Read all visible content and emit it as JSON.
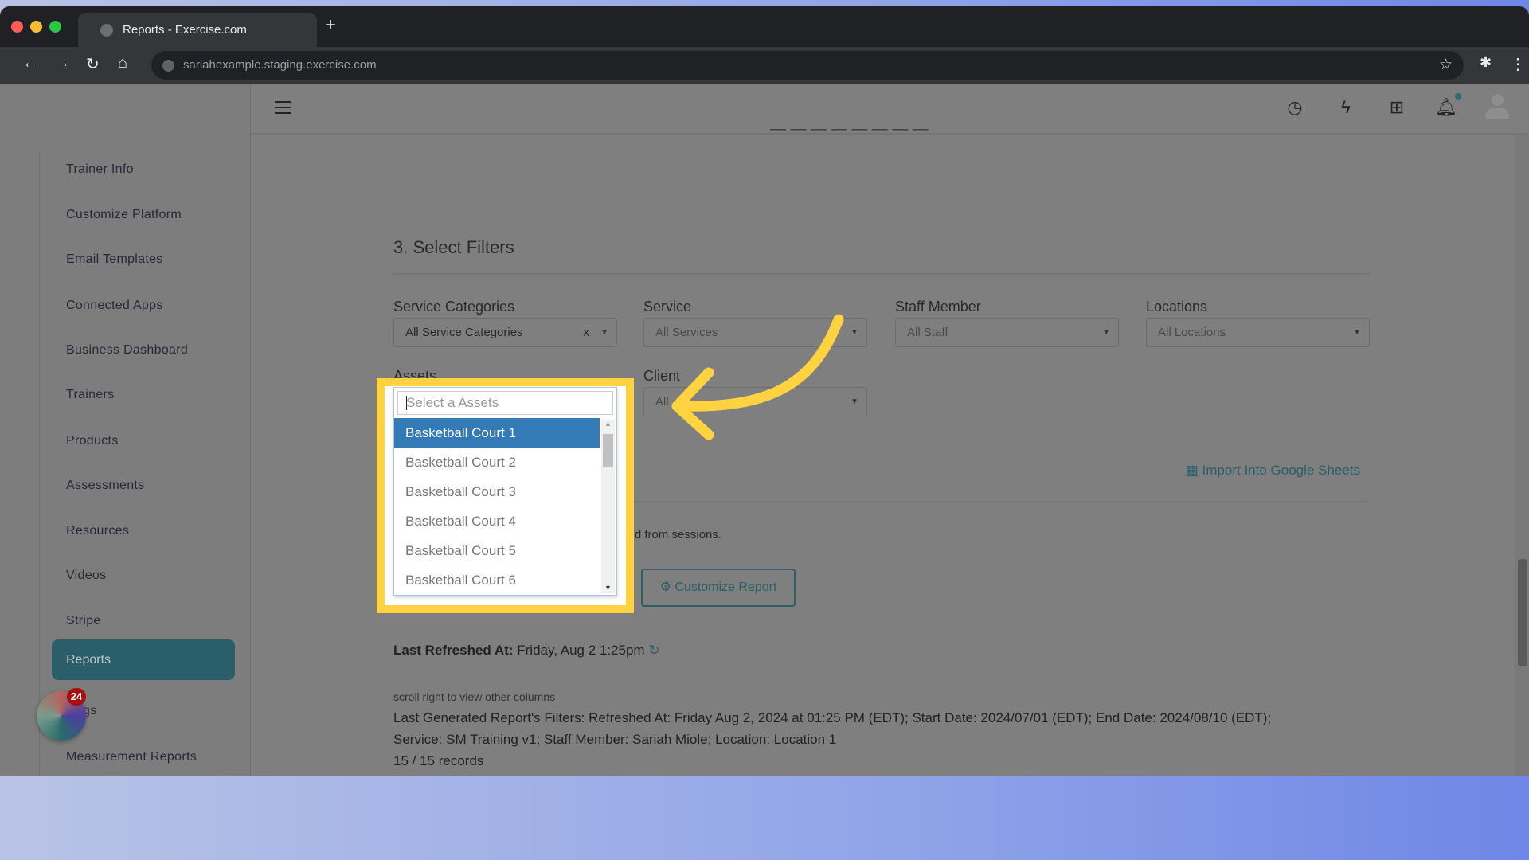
{
  "browser": {
    "tab_title": "Reports - Exercise.com",
    "url": "sariahexample.staging.exercise.com",
    "new_tab": "+"
  },
  "sidebar": {
    "items": [
      {
        "label": "Trainer Info"
      },
      {
        "label": "Customize Platform"
      },
      {
        "label": "Email Templates"
      },
      {
        "label": "Connected Apps"
      },
      {
        "label": "Business Dashboard"
      },
      {
        "label": "Trainers"
      },
      {
        "label": "Products"
      },
      {
        "label": "Assessments"
      },
      {
        "label": "Resources"
      },
      {
        "label": "Videos"
      },
      {
        "label": "Stripe"
      },
      {
        "label": "Reports",
        "active": true
      },
      {
        "label": "gs"
      },
      {
        "label": "Measurement Reports"
      }
    ],
    "chat_badge": "24"
  },
  "filters": {
    "heading": "3. Select Filters",
    "service_categories": {
      "label": "Service Categories",
      "value": "All Service Categories",
      "clear": "x"
    },
    "service": {
      "label": "Service",
      "value": "All Services"
    },
    "staff": {
      "label": "Staff Member",
      "value": "All Staff"
    },
    "locations": {
      "label": "Locations",
      "value": "All Locations"
    },
    "assets": {
      "label": "Assets",
      "placeholder": "Select a Assets",
      "options": [
        "Basketball Court 1",
        "Basketball Court 2",
        "Basketball Court 3",
        "Basketball Court 4",
        "Basketball Court 5",
        "Basketball Court 6"
      ],
      "highlighted": "Basketball Court 1"
    },
    "client": {
      "label": "Client",
      "value": "All"
    }
  },
  "report": {
    "import_label": "Import Into Google Sheets",
    "note_fragment": "rved from sessions.",
    "customize_label": "Customize Report",
    "last_refreshed_label": "Last Refreshed At:",
    "last_refreshed_value": "Friday, Aug 2 1:25pm",
    "scroll_hint": "scroll right to view other columns",
    "filters_line1": "Last Generated Report's Filters: Refreshed At: Friday Aug 2, 2024 at 01:25 PM (EDT); Start Date: 2024/07/01 (EDT); End Date: 2024/08/10 (EDT);",
    "filters_line2": "Service: SM Training v1; Staff Member: Sariah Miole; Location: Location 1",
    "records": "15 / 15 records"
  },
  "colors": {
    "highlight": "#ffd23f",
    "accent": "#2a5f69",
    "selected_option": "#337ab7"
  }
}
